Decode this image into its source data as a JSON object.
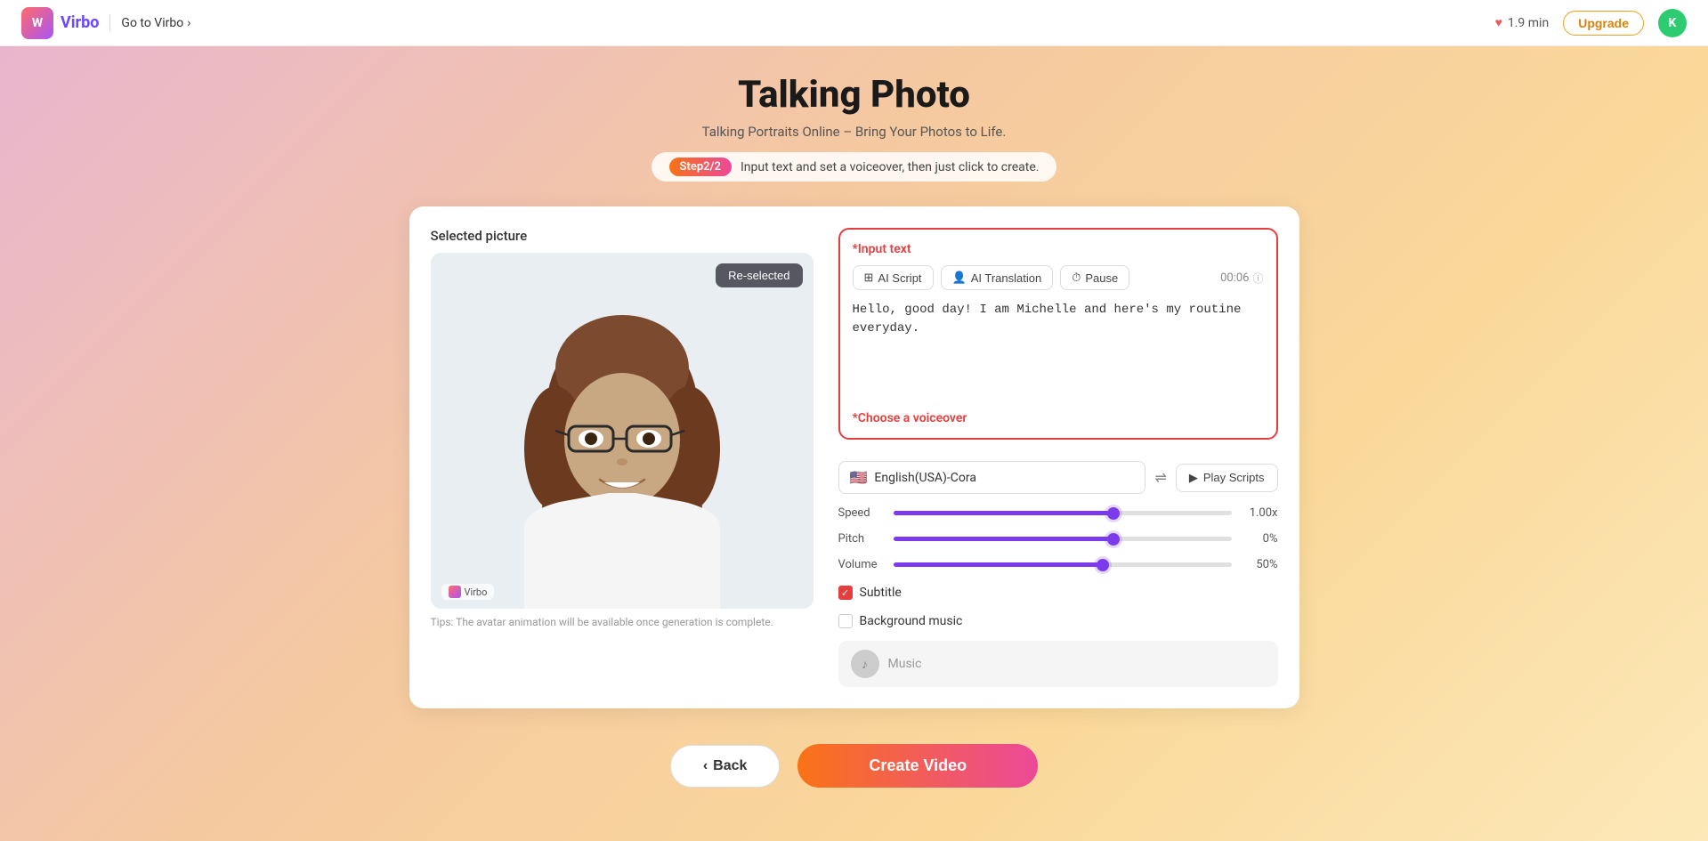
{
  "header": {
    "logo_text": "Virbo",
    "goto_label": "Go to Virbo",
    "timer_value": "1.9 min",
    "upgrade_label": "Upgrade",
    "avatar_initial": "K"
  },
  "page": {
    "title": "Talking Photo",
    "subtitle": "Talking Portraits Online – Bring Your Photos to Life.",
    "step_badge": "Step2/2",
    "step_instruction": "Input text and set a voiceover, then just click to create."
  },
  "left_panel": {
    "selected_picture_label": "Selected picture",
    "reselected_btn": "Re-selected",
    "watermark_text": "Virbo",
    "tips_text": "Tips: The avatar animation will be available once generation is complete."
  },
  "right_panel": {
    "input_text_label": "*Input text",
    "ai_script_label": "AI Script",
    "ai_translation_label": "AI Translation",
    "pause_label": "Pause",
    "time_display": "00:06",
    "input_text_content": "Hello, good day! I am Michelle and here's my routine everyday.",
    "voiceover_label": "*Choose a voiceover",
    "voice_name": "English(USA)-Cora",
    "play_scripts_label": "Play Scripts",
    "speed_label": "Speed",
    "speed_value": "1.00x",
    "speed_percent": 65,
    "pitch_label": "Pitch",
    "pitch_value": "0%",
    "pitch_percent": 65,
    "volume_label": "Volume",
    "volume_value": "50%",
    "volume_percent": 62,
    "subtitle_label": "Subtitle",
    "subtitle_checked": true,
    "background_music_label": "Background music",
    "background_music_checked": false,
    "music_label": "Music"
  },
  "bottom": {
    "back_label": "Back",
    "create_label": "Create Video"
  }
}
